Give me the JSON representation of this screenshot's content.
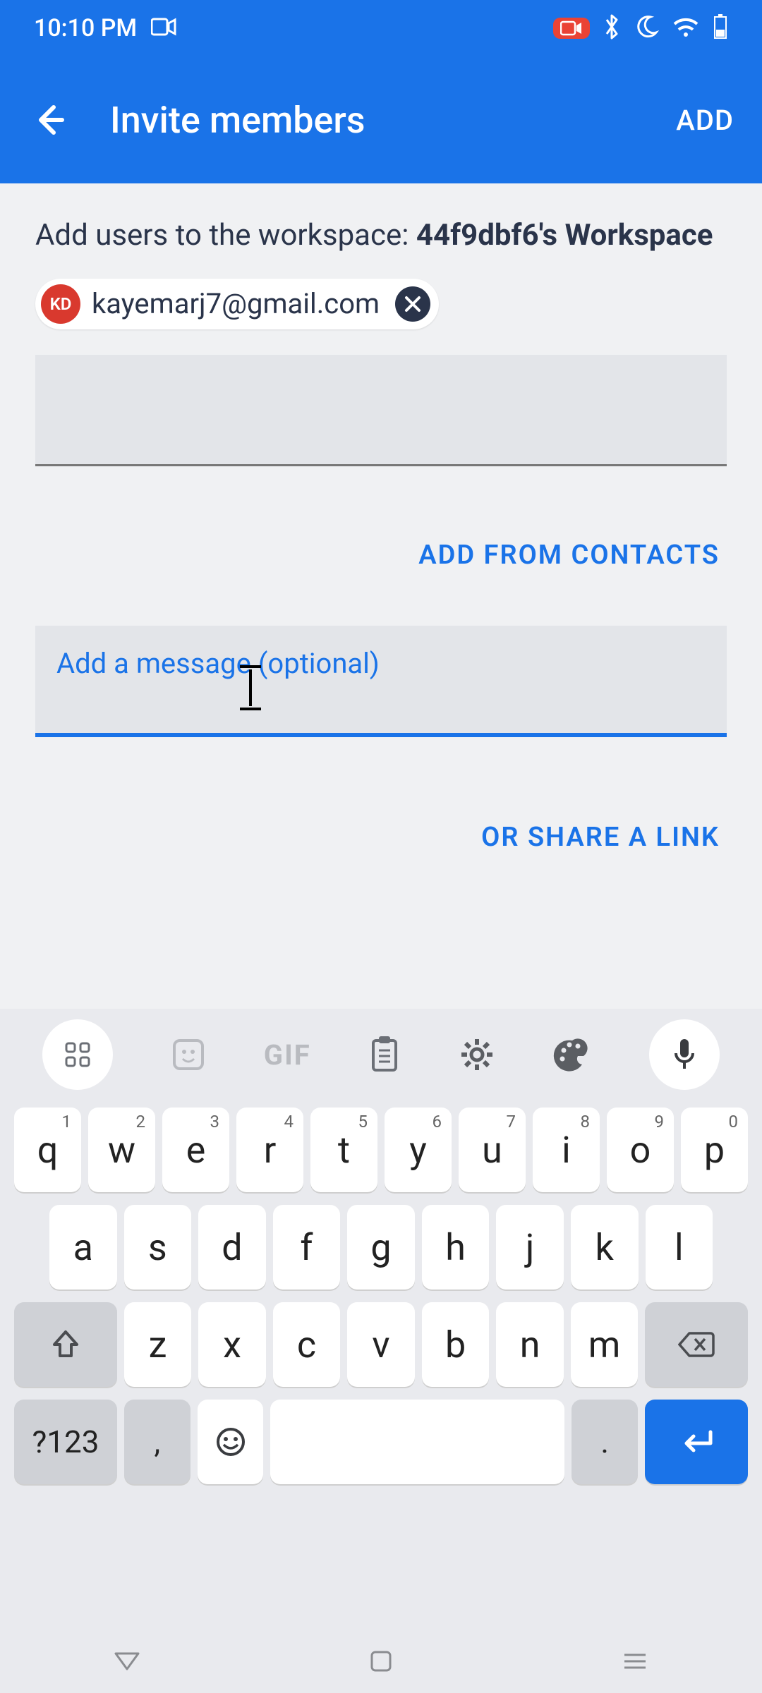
{
  "status": {
    "time": "10:10 PM"
  },
  "appbar": {
    "title": "Invite members",
    "action": "ADD"
  },
  "main": {
    "prefix": "Add users to the workspace: ",
    "workspace": "44f9dbf6's Workspace",
    "chip": {
      "initials": "KD",
      "email": "kayemarj7@gmail.com"
    },
    "add_contacts": "ADD FROM CONTACTS",
    "message_placeholder": "Add a message (optional)",
    "share_link": "OR SHARE A LINK"
  },
  "keyboard": {
    "gif": "GIF",
    "row1": [
      {
        "l": "q",
        "n": "1"
      },
      {
        "l": "w",
        "n": "2"
      },
      {
        "l": "e",
        "n": "3"
      },
      {
        "l": "r",
        "n": "4"
      },
      {
        "l": "t",
        "n": "5"
      },
      {
        "l": "y",
        "n": "6"
      },
      {
        "l": "u",
        "n": "7"
      },
      {
        "l": "i",
        "n": "8"
      },
      {
        "l": "o",
        "n": "9"
      },
      {
        "l": "p",
        "n": "0"
      }
    ],
    "row2": [
      "a",
      "s",
      "d",
      "f",
      "g",
      "h",
      "j",
      "k",
      "l"
    ],
    "row3": [
      "z",
      "x",
      "c",
      "v",
      "b",
      "n",
      "m"
    ],
    "sym": "?123",
    "comma": ",",
    "period": "."
  }
}
